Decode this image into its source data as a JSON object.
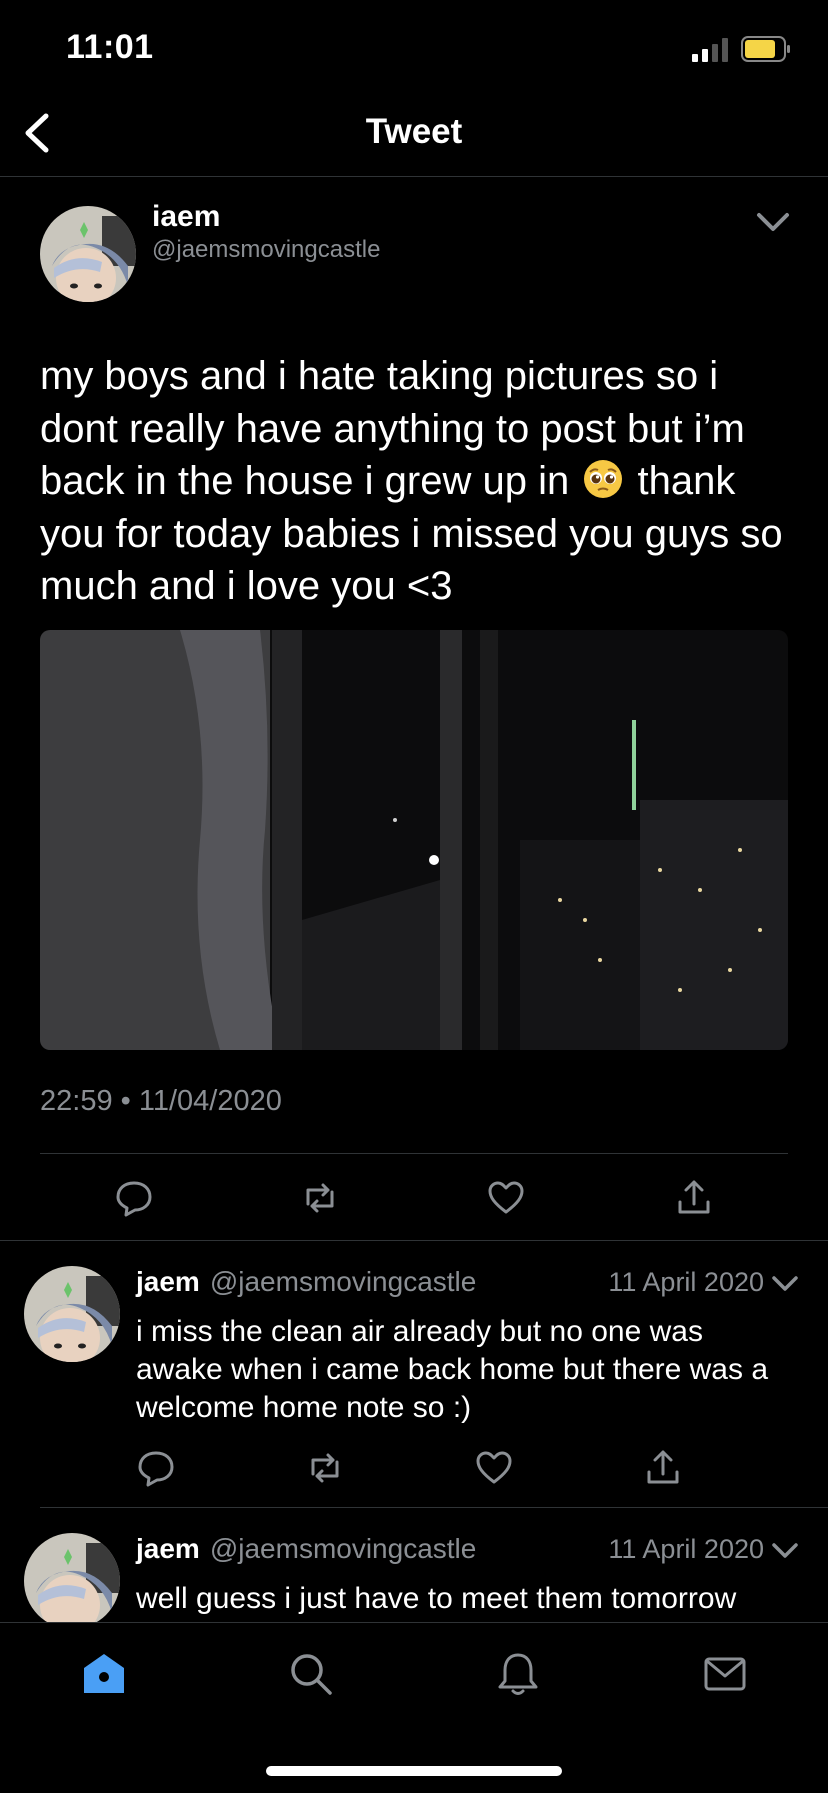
{
  "status_bar": {
    "time": "11:01"
  },
  "nav": {
    "title": "Tweet"
  },
  "tweet": {
    "author_name": "iaem",
    "author_handle": "@jaemsmovingcastle",
    "text_before_emoji": "my boys and i hate taking pictures so i dont really have anything to post but i’m back in the house i grew up in",
    "emoji": "pleading-face-emoji",
    "text_after_emoji": "thank you for today babies i missed you guys so much and i love you <3",
    "timestamp": "22:59 • 11/04/2020"
  },
  "replies": [
    {
      "name": "jaem",
      "handle": "@jaemsmovingcastle",
      "date": "11 April 2020",
      "text": "i miss the clean air already but no one was awake when i came back home but there was a welcome home note so :)"
    },
    {
      "name": "jaem",
      "handle": "@jaemsmovingcastle",
      "date": "11 April 2020",
      "text": "well guess i just have to meet them tomorrow"
    }
  ],
  "tabs": [
    "home-icon",
    "search-icon",
    "notifications-icon",
    "messages-icon"
  ],
  "colors": {
    "accent": "#4a9ff5",
    "background": "#000000",
    "secondary_text": "#8b8f94",
    "battery": "#f5d547"
  }
}
